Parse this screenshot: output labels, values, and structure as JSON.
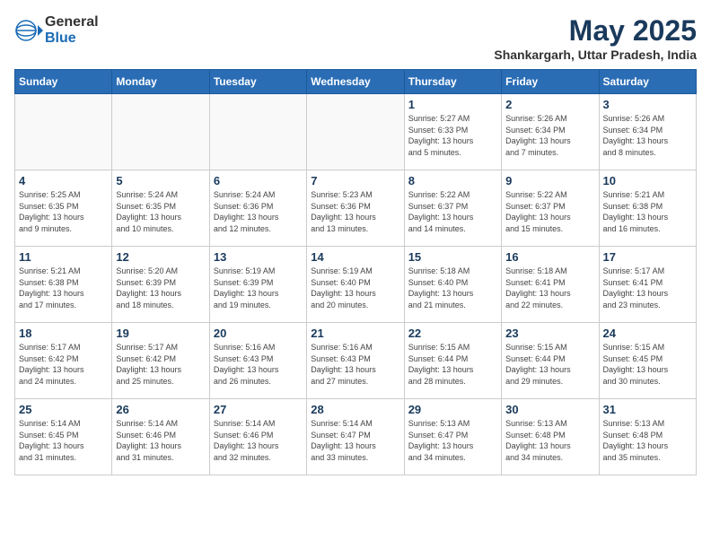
{
  "header": {
    "logo_general": "General",
    "logo_blue": "Blue",
    "month_year": "May 2025",
    "location": "Shankargarh, Uttar Pradesh, India"
  },
  "days_of_week": [
    "Sunday",
    "Monday",
    "Tuesday",
    "Wednesday",
    "Thursday",
    "Friday",
    "Saturday"
  ],
  "weeks": [
    [
      {
        "day": "",
        "info": ""
      },
      {
        "day": "",
        "info": ""
      },
      {
        "day": "",
        "info": ""
      },
      {
        "day": "",
        "info": ""
      },
      {
        "day": "1",
        "info": "Sunrise: 5:27 AM\nSunset: 6:33 PM\nDaylight: 13 hours\nand 5 minutes."
      },
      {
        "day": "2",
        "info": "Sunrise: 5:26 AM\nSunset: 6:34 PM\nDaylight: 13 hours\nand 7 minutes."
      },
      {
        "day": "3",
        "info": "Sunrise: 5:26 AM\nSunset: 6:34 PM\nDaylight: 13 hours\nand 8 minutes."
      }
    ],
    [
      {
        "day": "4",
        "info": "Sunrise: 5:25 AM\nSunset: 6:35 PM\nDaylight: 13 hours\nand 9 minutes."
      },
      {
        "day": "5",
        "info": "Sunrise: 5:24 AM\nSunset: 6:35 PM\nDaylight: 13 hours\nand 10 minutes."
      },
      {
        "day": "6",
        "info": "Sunrise: 5:24 AM\nSunset: 6:36 PM\nDaylight: 13 hours\nand 12 minutes."
      },
      {
        "day": "7",
        "info": "Sunrise: 5:23 AM\nSunset: 6:36 PM\nDaylight: 13 hours\nand 13 minutes."
      },
      {
        "day": "8",
        "info": "Sunrise: 5:22 AM\nSunset: 6:37 PM\nDaylight: 13 hours\nand 14 minutes."
      },
      {
        "day": "9",
        "info": "Sunrise: 5:22 AM\nSunset: 6:37 PM\nDaylight: 13 hours\nand 15 minutes."
      },
      {
        "day": "10",
        "info": "Sunrise: 5:21 AM\nSunset: 6:38 PM\nDaylight: 13 hours\nand 16 minutes."
      }
    ],
    [
      {
        "day": "11",
        "info": "Sunrise: 5:21 AM\nSunset: 6:38 PM\nDaylight: 13 hours\nand 17 minutes."
      },
      {
        "day": "12",
        "info": "Sunrise: 5:20 AM\nSunset: 6:39 PM\nDaylight: 13 hours\nand 18 minutes."
      },
      {
        "day": "13",
        "info": "Sunrise: 5:19 AM\nSunset: 6:39 PM\nDaylight: 13 hours\nand 19 minutes."
      },
      {
        "day": "14",
        "info": "Sunrise: 5:19 AM\nSunset: 6:40 PM\nDaylight: 13 hours\nand 20 minutes."
      },
      {
        "day": "15",
        "info": "Sunrise: 5:18 AM\nSunset: 6:40 PM\nDaylight: 13 hours\nand 21 minutes."
      },
      {
        "day": "16",
        "info": "Sunrise: 5:18 AM\nSunset: 6:41 PM\nDaylight: 13 hours\nand 22 minutes."
      },
      {
        "day": "17",
        "info": "Sunrise: 5:17 AM\nSunset: 6:41 PM\nDaylight: 13 hours\nand 23 minutes."
      }
    ],
    [
      {
        "day": "18",
        "info": "Sunrise: 5:17 AM\nSunset: 6:42 PM\nDaylight: 13 hours\nand 24 minutes."
      },
      {
        "day": "19",
        "info": "Sunrise: 5:17 AM\nSunset: 6:42 PM\nDaylight: 13 hours\nand 25 minutes."
      },
      {
        "day": "20",
        "info": "Sunrise: 5:16 AM\nSunset: 6:43 PM\nDaylight: 13 hours\nand 26 minutes."
      },
      {
        "day": "21",
        "info": "Sunrise: 5:16 AM\nSunset: 6:43 PM\nDaylight: 13 hours\nand 27 minutes."
      },
      {
        "day": "22",
        "info": "Sunrise: 5:15 AM\nSunset: 6:44 PM\nDaylight: 13 hours\nand 28 minutes."
      },
      {
        "day": "23",
        "info": "Sunrise: 5:15 AM\nSunset: 6:44 PM\nDaylight: 13 hours\nand 29 minutes."
      },
      {
        "day": "24",
        "info": "Sunrise: 5:15 AM\nSunset: 6:45 PM\nDaylight: 13 hours\nand 30 minutes."
      }
    ],
    [
      {
        "day": "25",
        "info": "Sunrise: 5:14 AM\nSunset: 6:45 PM\nDaylight: 13 hours\nand 31 minutes."
      },
      {
        "day": "26",
        "info": "Sunrise: 5:14 AM\nSunset: 6:46 PM\nDaylight: 13 hours\nand 31 minutes."
      },
      {
        "day": "27",
        "info": "Sunrise: 5:14 AM\nSunset: 6:46 PM\nDaylight: 13 hours\nand 32 minutes."
      },
      {
        "day": "28",
        "info": "Sunrise: 5:14 AM\nSunset: 6:47 PM\nDaylight: 13 hours\nand 33 minutes."
      },
      {
        "day": "29",
        "info": "Sunrise: 5:13 AM\nSunset: 6:47 PM\nDaylight: 13 hours\nand 34 minutes."
      },
      {
        "day": "30",
        "info": "Sunrise: 5:13 AM\nSunset: 6:48 PM\nDaylight: 13 hours\nand 34 minutes."
      },
      {
        "day": "31",
        "info": "Sunrise: 5:13 AM\nSunset: 6:48 PM\nDaylight: 13 hours\nand 35 minutes."
      }
    ]
  ]
}
